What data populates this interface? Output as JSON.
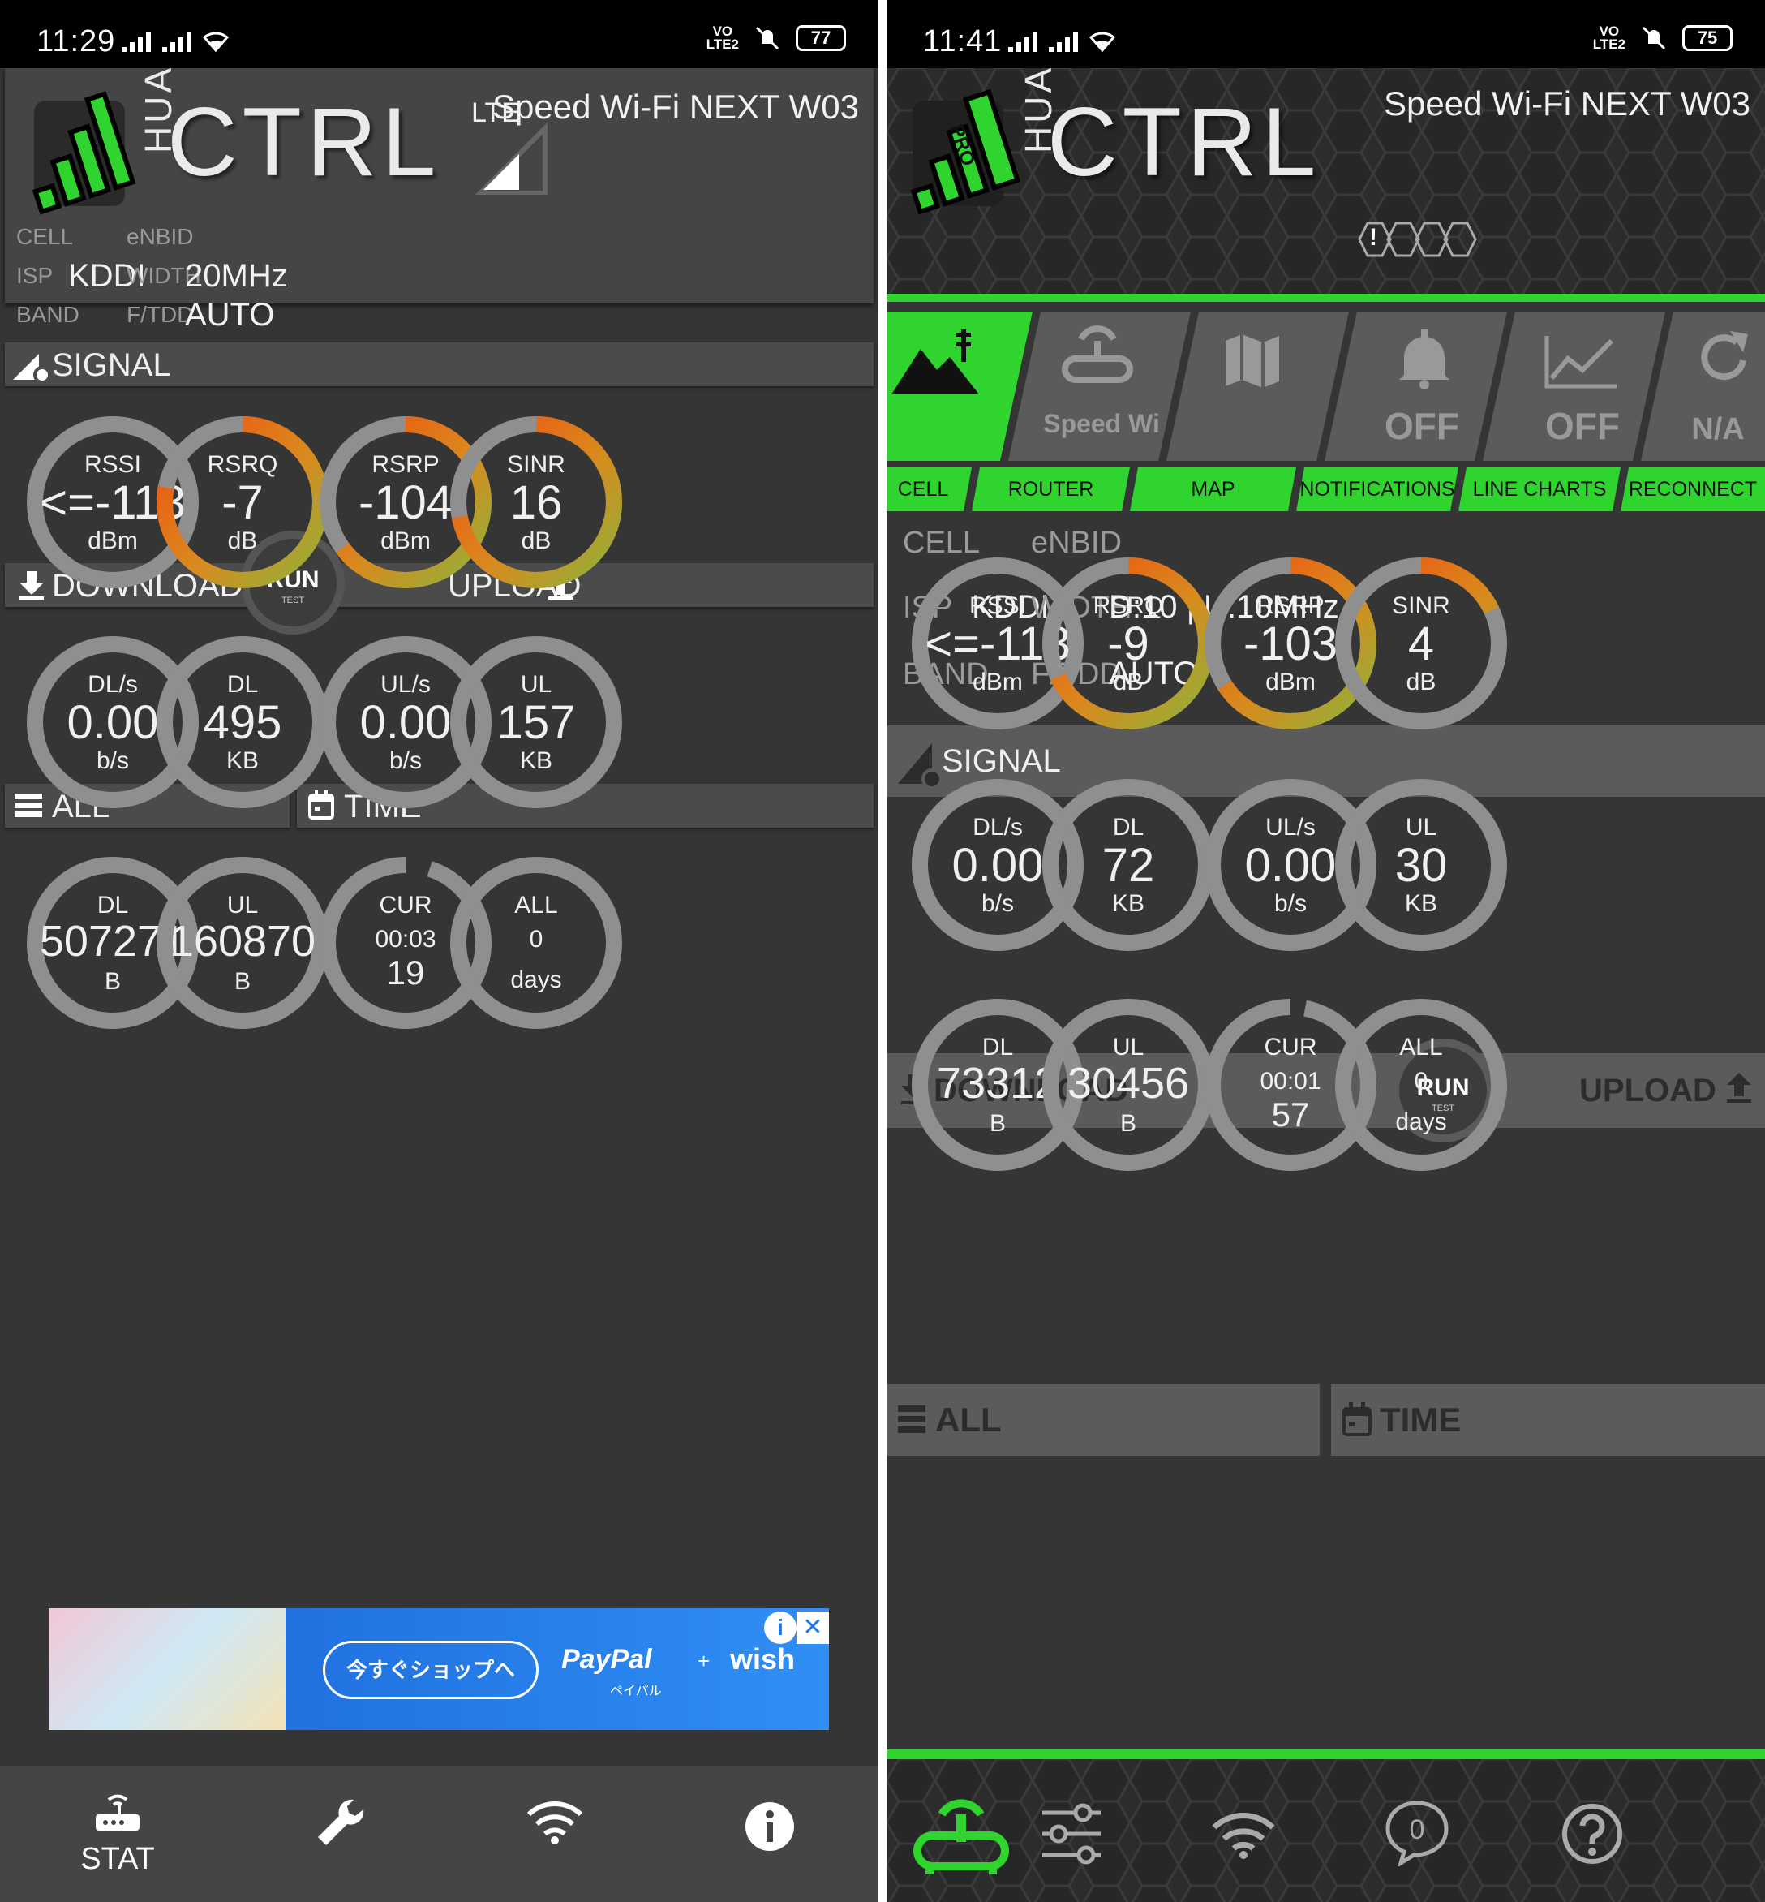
{
  "screens": {
    "a": {
      "status": {
        "time": "11:29",
        "battery": "77",
        "volte": "VO\nLTE2"
      },
      "header": {
        "device": "Speed Wi-Fi NEXT W03",
        "brand_side": "HUA",
        "brand_main": "CTRL",
        "network": "LTE"
      },
      "info": {
        "cell_key": "CELL",
        "enbid_key": "eNBID",
        "isp_key": "ISP",
        "isp_val": "KDDI",
        "width_key": "WIDTH",
        "width_val": "20MHz",
        "band_key": "BAND",
        "ftdd_key": "F/TDD",
        "ftdd_val": "AUTO"
      },
      "signal_title": "SIGNAL",
      "signal": [
        {
          "name": "RSSI",
          "value": "<=-113",
          "unit": "dBm",
          "level": 0
        },
        {
          "name": "RSRQ",
          "value": "-7",
          "unit": "dB",
          "level": 0.78
        },
        {
          "name": "RSRP",
          "value": "-104",
          "unit": "dBm",
          "level": 0.65
        },
        {
          "name": "SINR",
          "value": "16",
          "unit": "dB",
          "level": 0.72
        }
      ],
      "download_title": "DOWNLOAD",
      "upload_title": "UPLOAD",
      "run": {
        "label": "RUN",
        "sub": "TEST"
      },
      "traffic": [
        {
          "name": "DL/s",
          "value": "0.00",
          "unit": "b/s"
        },
        {
          "name": "DL",
          "value": "495",
          "unit": "KB"
        },
        {
          "name": "UL/s",
          "value": "0.00",
          "unit": "b/s"
        },
        {
          "name": "UL",
          "value": "157",
          "unit": "KB"
        }
      ],
      "all_title": "ALL",
      "time_title": "TIME",
      "totals": [
        {
          "name": "DL",
          "value": "507271",
          "unit": "B"
        },
        {
          "name": "UL",
          "value": "160870",
          "unit": "B"
        }
      ],
      "time": [
        {
          "name": "CUR",
          "mid": "00:03",
          "low": "19",
          "level": 0.05
        },
        {
          "name": "ALL",
          "mid": "0",
          "low": "days"
        }
      ],
      "ad": {
        "cta": "今すぐショップへ",
        "brand1": "PayPal",
        "brand1_sub": "ペイパル",
        "plus": "+",
        "brand2": "wish",
        "info": "i",
        "close": "✕"
      },
      "nav": [
        {
          "icon": "router-icon",
          "label": "STAT"
        },
        {
          "icon": "wrench-icon",
          "label": ""
        },
        {
          "icon": "wifi-icon",
          "label": ""
        },
        {
          "icon": "info-icon",
          "label": ""
        }
      ]
    },
    "b": {
      "status": {
        "time": "11:41",
        "battery": "75",
        "volte": "VO\nLTE2"
      },
      "header": {
        "device": "Speed Wi-Fi NEXT W03",
        "brand_side": "HUA",
        "brand_main": "CTRL",
        "badge": "PRO",
        "alert": "!"
      },
      "tabs": [
        {
          "label": "CELL",
          "value": "",
          "icon": "tower-icon"
        },
        {
          "label": "ROUTER",
          "value": "Speed Wi",
          "icon": "router-icon"
        },
        {
          "label": "MAP",
          "value": "",
          "icon": "map-icon"
        },
        {
          "label": "NOTIFICATIONS",
          "value": "OFF",
          "icon": "bell-icon"
        },
        {
          "label": "LINE CHARTS",
          "value": "OFF",
          "icon": "chart-icon"
        },
        {
          "label": "RECONNECT",
          "value": "N/A",
          "icon": "refresh-icon"
        }
      ],
      "info": {
        "cell_key": "CELL",
        "enbid_key": "eNBID",
        "isp_key": "ISP",
        "isp_val": "KDDI",
        "width_key": "WIDTH",
        "width_val": "D:10 | U:10MHz",
        "band_key": "BAND",
        "ftdd_key": "F/TDD",
        "ftdd_val": "AUTO"
      },
      "signal_title": "SIGNAL",
      "signal": [
        {
          "name": "RSSI",
          "value": "<=-113",
          "unit": "dBm",
          "level": 0
        },
        {
          "name": "RSRQ",
          "value": "-9",
          "unit": "dB",
          "level": 0.68
        },
        {
          "name": "RSRP",
          "value": "-103",
          "unit": "dBm",
          "level": 0.66
        },
        {
          "name": "SINR",
          "value": "4",
          "unit": "dB",
          "level": 0.18
        }
      ],
      "download_title": "DOWNLOAD",
      "upload_title": "UPLOAD",
      "run": {
        "label": "RUN",
        "sub": "TEST"
      },
      "traffic": [
        {
          "name": "DL/s",
          "value": "0.00",
          "unit": "b/s"
        },
        {
          "name": "DL",
          "value": "72",
          "unit": "KB"
        },
        {
          "name": "UL/s",
          "value": "0.00",
          "unit": "b/s"
        },
        {
          "name": "UL",
          "value": "30",
          "unit": "KB"
        }
      ],
      "all_title": "ALL",
      "time_title": "TIME",
      "totals": [
        {
          "name": "DL",
          "value": "73312",
          "unit": "B"
        },
        {
          "name": "UL",
          "value": "30456",
          "unit": "B"
        }
      ],
      "time": [
        {
          "name": "CUR",
          "mid": "00:01",
          "low": "57",
          "level": 0.03
        },
        {
          "name": "ALL",
          "mid": "0",
          "low": "days"
        }
      ],
      "nav": [
        {
          "icon": "router-icon"
        },
        {
          "icon": "sliders-icon"
        },
        {
          "icon": "wifi-icon"
        },
        {
          "icon": "chat-icon",
          "badge": "0"
        },
        {
          "icon": "help-icon"
        }
      ]
    }
  },
  "colors": {
    "accent_green": "#2fd42f",
    "gauge_grey": "#8f8f8f",
    "gauge_orange": "#f04e10",
    "gauge_yellow": "#8fb23a",
    "bg_dark": "#353535"
  }
}
